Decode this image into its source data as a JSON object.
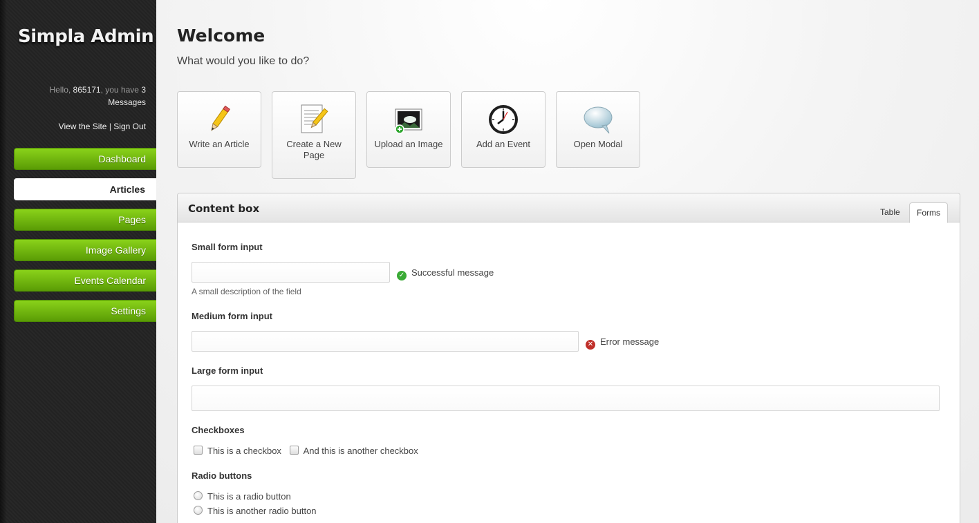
{
  "sidebar": {
    "title": "Simpla Admin",
    "greeting_prefix": "Hello,",
    "username": "865171",
    "greeting_mid": ", you have",
    "message_count": "3",
    "greeting_suffix": "Messages",
    "view_site": "View the Site",
    "separator": "|",
    "sign_out": "Sign Out",
    "items": [
      {
        "label": "Dashboard"
      },
      {
        "label": "Articles"
      },
      {
        "label": "Pages"
      },
      {
        "label": "Image Gallery"
      },
      {
        "label": "Events Calendar"
      },
      {
        "label": "Settings"
      }
    ],
    "active_item": "Articles",
    "accent_color": "#6fb80f"
  },
  "main": {
    "title": "Welcome",
    "subtitle": "What would you like to do?"
  },
  "shortcuts": [
    {
      "label": "Write an Article",
      "icon": "pencil-icon"
    },
    {
      "label": "Create a New Page",
      "icon": "document-pencil-icon"
    },
    {
      "label": "Upload an Image",
      "icon": "image-upload-icon"
    },
    {
      "label": "Add an Event",
      "icon": "clock-icon"
    },
    {
      "label": "Open Modal",
      "icon": "speech-bubble-icon"
    }
  ],
  "content_box": {
    "title": "Content box",
    "tabs": [
      {
        "label": "Table"
      },
      {
        "label": "Forms"
      }
    ],
    "active_tab": "Forms",
    "form": {
      "small": {
        "label": "Small form input",
        "value": "",
        "success_message": "Successful message",
        "description": "A small description of the field"
      },
      "medium": {
        "label": "Medium form input",
        "value": "",
        "error_message": "Error message"
      },
      "large": {
        "label": "Large form input",
        "value": ""
      },
      "checkboxes": {
        "label": "Checkboxes",
        "options": [
          "This is a checkbox",
          "And this is another checkbox"
        ]
      },
      "radios": {
        "label": "Radio buttons",
        "options": [
          "This is a radio button",
          "This is another radio button"
        ]
      }
    },
    "success_color": "#3aaa35",
    "error_color": "#c0302a"
  }
}
